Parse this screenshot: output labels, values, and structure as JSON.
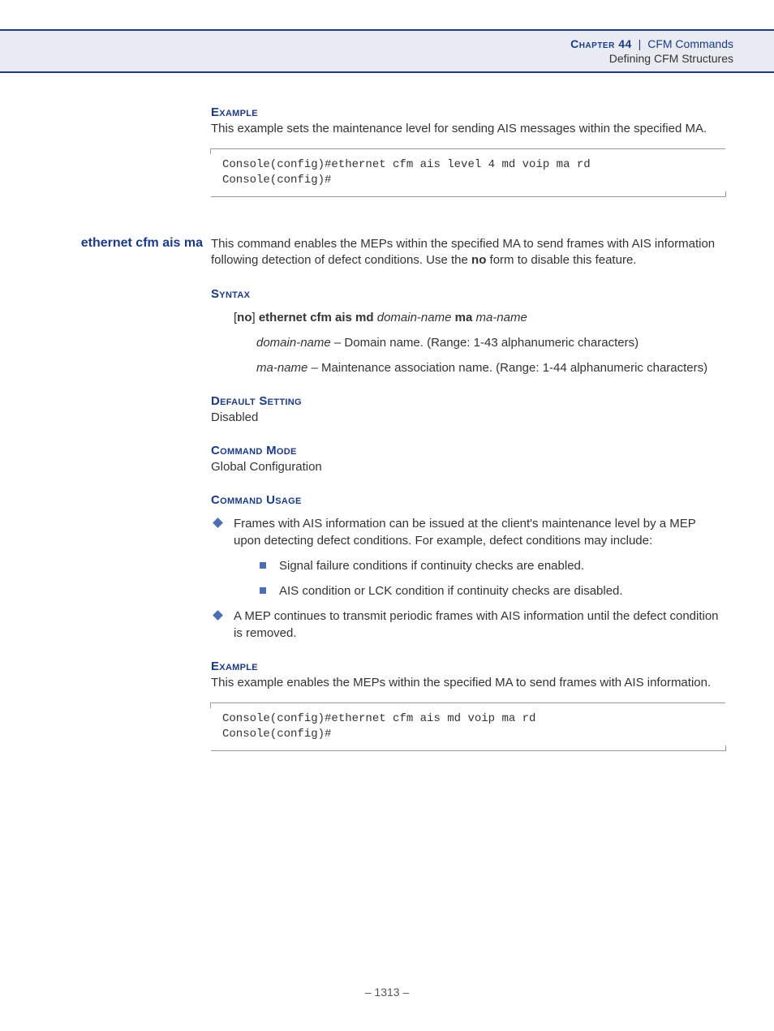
{
  "header": {
    "chapter_label": "Chapter 44",
    "chapter_title": "CFM Commands",
    "subtitle": "Defining CFM Structures"
  },
  "section1": {
    "example_label": "Example",
    "example_text": "This example sets the maintenance level for sending AIS messages within the specified MA.",
    "code": "Console(config)#ethernet cfm ais level 4 md voip ma rd\nConsole(config)#"
  },
  "section2": {
    "sidehead": "ethernet cfm ais ma",
    "intro_pre": "This command enables the MEPs within the specified MA to send frames with AIS information following detection of defect conditions. Use the ",
    "intro_bold": "no",
    "intro_post": " form to disable this feature.",
    "syntax_label": "Syntax",
    "syntax_line": {
      "open": "[",
      "no": "no",
      "close_cmd": "] ",
      "cmd1": "ethernet cfm ais md ",
      "arg1": "domain-name",
      "cmd2": " ma ",
      "arg2": "ma-name"
    },
    "param1_name": "domain-name",
    "param1_desc": " – Domain name. (Range: 1-43 alphanumeric characters)",
    "param2_name": "ma-name",
    "param2_desc": " – Maintenance association name. (Range: 1-44 alphanumeric characters)",
    "default_label": "Default Setting",
    "default_value": "Disabled",
    "mode_label": "Command Mode",
    "mode_value": "Global Configuration",
    "usage_label": "Command Usage",
    "usage_items": [
      "Frames with AIS information can be issued at the client's maintenance level by a MEP upon detecting defect conditions. For example, defect conditions may include:",
      "A MEP continues to transmit periodic frames with AIS information until the defect condition is removed."
    ],
    "usage_subitems": [
      "Signal failure conditions if continuity checks are enabled.",
      "AIS condition or LCK condition if continuity checks are disabled."
    ],
    "example_label": "Example",
    "example_text": "This example enables the MEPs within the specified MA to send frames with AIS information.",
    "code": "Console(config)#ethernet cfm ais md voip ma rd\nConsole(config)#"
  },
  "footer": {
    "page_number": "–  1313  –"
  }
}
